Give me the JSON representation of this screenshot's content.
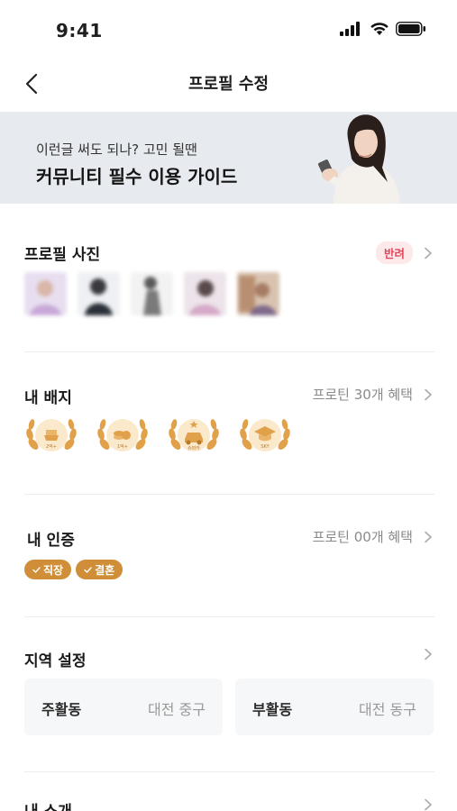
{
  "status_bar": {
    "time": "9:41"
  },
  "nav": {
    "title": "프로필 수정"
  },
  "banner": {
    "subtitle": "이런글 써도 되나? 고민 될땐",
    "title": "커뮤니티 필수 이용 가이드"
  },
  "profile_photo": {
    "title": "프로필 사진",
    "status_badge": "반려",
    "photos": [
      "photo-1",
      "photo-2",
      "photo-3",
      "photo-4",
      "photo-5"
    ]
  },
  "my_badges": {
    "title": "내 배지",
    "right_text": "프로틴 30개 혜택",
    "badges": [
      {
        "name": "laurel-badge-icon",
        "label": "2억+"
      },
      {
        "name": "laurel-badge-icon",
        "label": "1억+"
      },
      {
        "name": "laurel-badge-icon",
        "label": "슈퍼카"
      },
      {
        "name": "laurel-badge-icon",
        "label": "SKY"
      }
    ]
  },
  "my_verification": {
    "title": "내 인증",
    "right_text": "프로틴 00개 혜택",
    "chips": [
      "직장",
      "결혼"
    ]
  },
  "region": {
    "title": "지역 설정",
    "primary_label": "주활동",
    "primary_value": "대전 중구",
    "secondary_label": "부활동",
    "secondary_value": "대전 동구"
  },
  "intro": {
    "title": "내 소개"
  },
  "colors": {
    "accent": "#cf8e37",
    "banner_bg": "#e7eaee",
    "reject": "#e0475c"
  }
}
